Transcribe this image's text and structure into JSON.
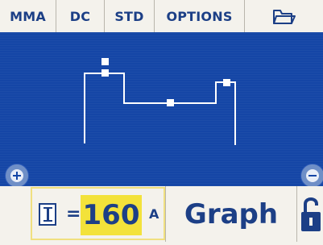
{
  "tabs": [
    {
      "label": "MMA"
    },
    {
      "label": "DC"
    },
    {
      "label": "STD"
    },
    {
      "label": "OPTIONS"
    }
  ],
  "folder_icon": "folder-open-icon",
  "graph": {
    "background": "#1546a6",
    "line_color": "#ffffff"
  },
  "zoom": {
    "in_icon": "zoom-in-icon",
    "out_icon": "zoom-out-icon"
  },
  "current": {
    "symbol_icon": "current-i-icon",
    "equals": "=",
    "value": "160",
    "unit": "A",
    "highlight_color": "#f3e23a"
  },
  "graph_button": {
    "label": "Graph"
  },
  "lock_icon": "unlocked-padlock-icon",
  "colors": {
    "accent": "#1c3f86",
    "panel": "#1546a6",
    "bar": "#f4f2ec"
  }
}
